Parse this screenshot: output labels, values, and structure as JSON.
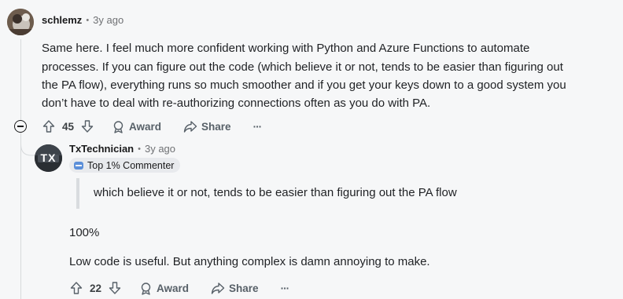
{
  "comment1": {
    "username": "schlemz",
    "time": "3y ago",
    "lines": [
      "Same here. I feel much more confident working with Python and Azure Functions to automate",
      "processes. If you can figure out the code (which believe it or not, tends to be easier than figuring out",
      "the PA flow), everything runs so much smoother and if you get your keys down to a good system you",
      "don’t have to deal with re-authorizing connections often as you do with PA."
    ],
    "votes": "45",
    "award_label": "Award",
    "share_label": "Share",
    "more_label": "···"
  },
  "comment2": {
    "username": "TxTechnician",
    "time": "3y ago",
    "badge": "Top 1% Commenter",
    "avatar_text": "TX",
    "quote": "which believe it or not, tends to be easier than figuring out the PA flow",
    "paragraph1": "100%",
    "paragraph2": "Low code is useful. But anything complex is damn annoying to make.",
    "votes": "22",
    "award_label": "Award",
    "share_label": "Share",
    "more_label": "···"
  },
  "meta_separator": "•"
}
